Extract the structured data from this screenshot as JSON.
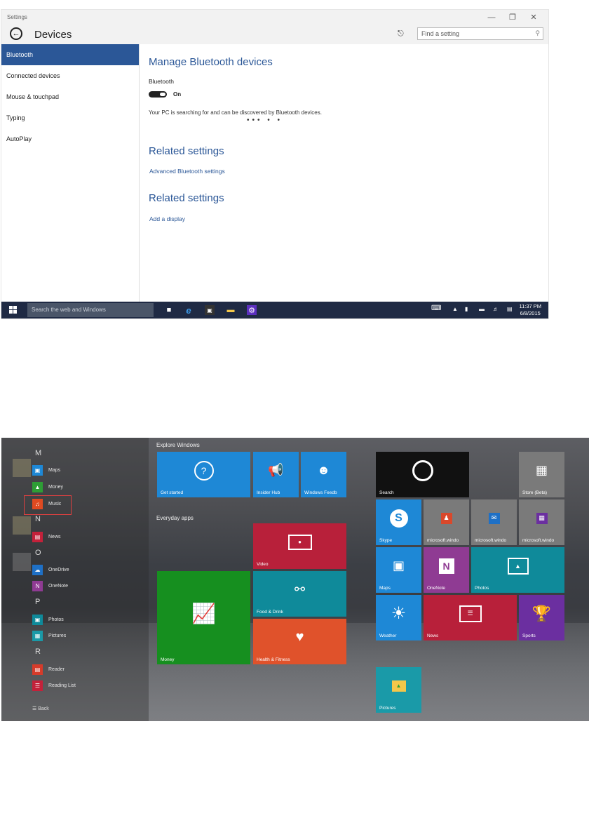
{
  "settings_window": {
    "title": "Settings",
    "header": {
      "page_title": "Devices",
      "search_placeholder": "Find a setting"
    },
    "nav": [
      {
        "label": "Bluetooth",
        "active": true
      },
      {
        "label": "Connected devices",
        "active": false
      },
      {
        "label": "Mouse & touchpad",
        "active": false
      },
      {
        "label": "Typing",
        "active": false
      },
      {
        "label": "AutoPlay",
        "active": false
      }
    ],
    "content": {
      "heading": "Manage Bluetooth devices",
      "bluetooth_label": "Bluetooth",
      "toggle_state": "On",
      "description": "Your PC is searching for and can be discovered by Bluetooth devices.",
      "busy_indicator": "••• •  •",
      "related1": {
        "heading": "Related settings",
        "link": "Advanced Bluetooth settings"
      },
      "related2": {
        "heading": "Related settings",
        "link": "Add a display"
      }
    },
    "taskbar": {
      "search_placeholder": "Search the web and Windows",
      "time": "11:37 PM",
      "date": "6/8/2015"
    }
  },
  "start_menu": {
    "letters": {
      "m": "M",
      "n": "N",
      "o": "O",
      "p": "P",
      "r": "R"
    },
    "apps": [
      {
        "name": "Maps",
        "color": "#1e88d6"
      },
      {
        "name": "Money",
        "color": "#2e9e35"
      },
      {
        "name": "Music",
        "color": "#e04a21"
      },
      {
        "name": "News",
        "color": "#c4213a"
      },
      {
        "name": "OneDrive",
        "color": "#1e70c6"
      },
      {
        "name": "OneNote",
        "color": "#8f3b93"
      },
      {
        "name": "Photos",
        "color": "#0f8a9a"
      },
      {
        "name": "Pictures",
        "color": "#1a9aa8"
      },
      {
        "name": "Reader",
        "color": "#d63b2a"
      },
      {
        "name": "Reading List",
        "color": "#c4213a"
      }
    ],
    "back_label": "Back",
    "group1_title": "Explore Windows",
    "group2_title": "Everyday apps",
    "tiles": {
      "get_started": "Get started",
      "insider_hub": "Insider Hub",
      "windows_feedback": "Windows Feedb",
      "search": "Search",
      "store": "Store (Beta)",
      "video": "Video",
      "money": "Money",
      "food": "Food & Drink",
      "health": "Health & Fitness",
      "skype": "Skype",
      "ms1": "microsoft.windo",
      "ms2": "microsoft.windo",
      "ms3": "microsoft.windo",
      "maps": "Maps",
      "onenote": "OneNote",
      "photos": "Photos",
      "weather": "Weather",
      "news": "News",
      "sports": "Sports",
      "pictures": "Pictures"
    },
    "colors": {
      "blue": "#1e88d6",
      "red": "#b8203a",
      "teal": "#0f8a9a",
      "green": "#168f1f",
      "orange": "#e0522b",
      "purple": "#6b2fa0",
      "gray": "#7a7a7a",
      "black": "#111111"
    }
  }
}
